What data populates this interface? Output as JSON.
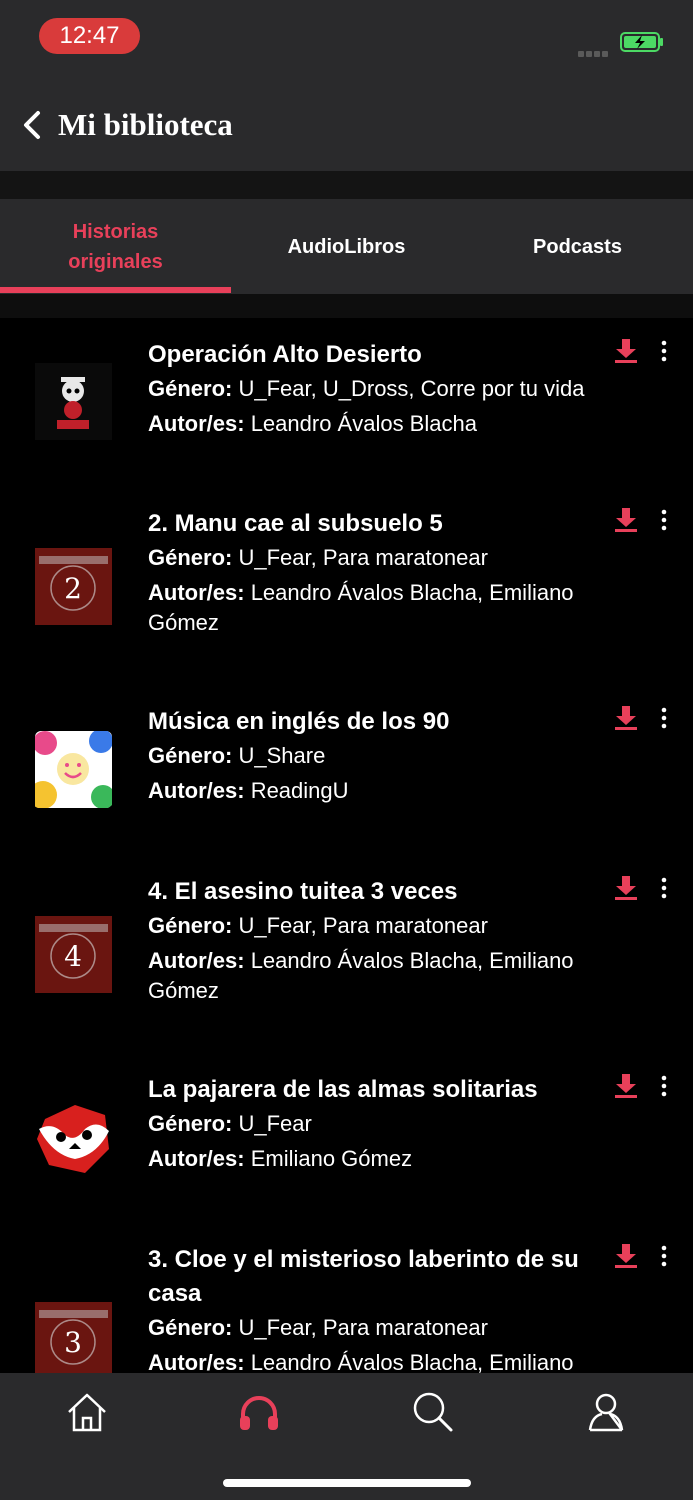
{
  "status_bar": {
    "time": "12:47",
    "battery_color": "#4cd964",
    "time_pill_color": "#d93b3b"
  },
  "header": {
    "title": "Mi biblioteca",
    "back_icon": "chevron-left-icon"
  },
  "tabs": [
    {
      "label": "Historias originales",
      "active": true
    },
    {
      "label": "AudioLibros",
      "active": false
    },
    {
      "label": "Podcasts",
      "active": false
    }
  ],
  "accent_color": "#e8405a",
  "labels": {
    "genre": "Género:",
    "authors": "Autor/es:"
  },
  "items": [
    {
      "title": "Operación Alto Desierto",
      "genre": "U_Fear, U_Dross, Corre por tu vida",
      "authors": "Leandro Ávalos Blacha",
      "cover_badge": ""
    },
    {
      "title": "2. Manu cae al subsuelo 5",
      "genre": "U_Fear, Para maratonear",
      "authors": "Leandro Ávalos Blacha, Emiliano Gómez",
      "cover_badge": "2"
    },
    {
      "title": "Música en inglés de los 90",
      "genre": "U_Share",
      "authors": "ReadingU",
      "cover_badge": ""
    },
    {
      "title": "4. El asesino tuitea 3 veces",
      "genre": "U_Fear, Para maratonear",
      "authors": "Leandro Ávalos Blacha, Emiliano Gómez",
      "cover_badge": "4"
    },
    {
      "title": "La pajarera de las almas solitarias",
      "genre": "U_Fear",
      "authors": "Emiliano Gómez",
      "cover_badge": ""
    },
    {
      "title": "3. Cloe y el misterioso laberinto de su casa",
      "genre": "U_Fear, Para maratonear",
      "authors": "Leandro Ávalos Blacha, Emiliano Gómez",
      "cover_badge": "3"
    }
  ],
  "bottom_nav": [
    {
      "icon": "home-icon",
      "active": false
    },
    {
      "icon": "headphones-icon",
      "active": true
    },
    {
      "icon": "search-icon",
      "active": false
    },
    {
      "icon": "profile-icon",
      "active": false
    }
  ]
}
